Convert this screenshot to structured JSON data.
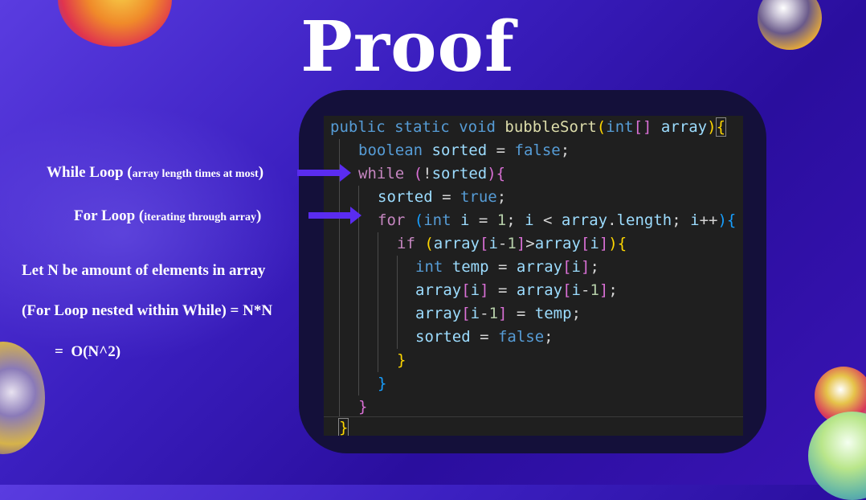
{
  "slide": {
    "title": "Proof",
    "annotations": {
      "while_label_main": "While Loop (",
      "while_label_small": "array length times at most",
      "while_label_end": ")",
      "for_label_main": "For Loop (",
      "for_label_small": "iterating through array",
      "for_label_end": ")",
      "let_n": "Let N be amount of elements in array",
      "nested": "(For Loop nested within While) = N*N",
      "result": "=  O(N^2)"
    }
  },
  "code": {
    "tokens": {
      "public": "public",
      "static": "static",
      "void": "void",
      "bubbleSort": "bubbleSort",
      "int": "int",
      "array": "array",
      "boolean": "boolean",
      "sorted": "sorted",
      "false": "false",
      "true": "true",
      "while": "while",
      "for": "for",
      "i": "i",
      "one": "1",
      "length": "length",
      "if": "if",
      "temp": "temp"
    }
  },
  "colors": {
    "background": "#3b1fc0",
    "editor_bg": "#1f1f1f",
    "arrow": "#5a2cf0",
    "keyword": "#569cd6",
    "control_keyword": "#c586c0",
    "function": "#dcdcaa",
    "variable": "#9cdcfe"
  }
}
